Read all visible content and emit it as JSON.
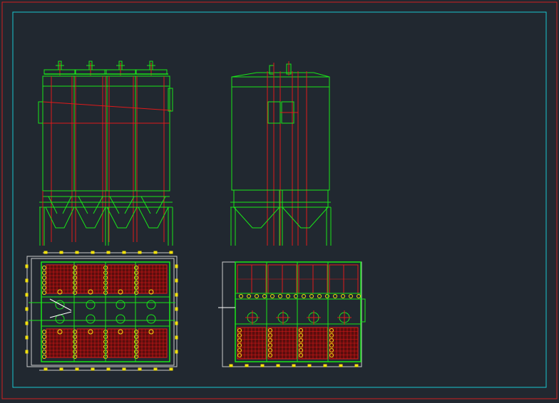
{
  "drawing": {
    "background": "#212830",
    "colors": {
      "outer_frame": "#d11f1f",
      "inner_frame": "#19c6d1",
      "geometry": "#19e619",
      "section_lines": "#e01a1a",
      "dimensions": "#f2e20d",
      "annotation": "#ffffff"
    },
    "views": [
      {
        "id": "front-elevation",
        "modules": 4
      },
      {
        "id": "side-elevation",
        "modules": 2
      },
      {
        "id": "top-plan",
        "modules": 4
      },
      {
        "id": "side-section-plan",
        "modules": 4
      }
    ]
  }
}
